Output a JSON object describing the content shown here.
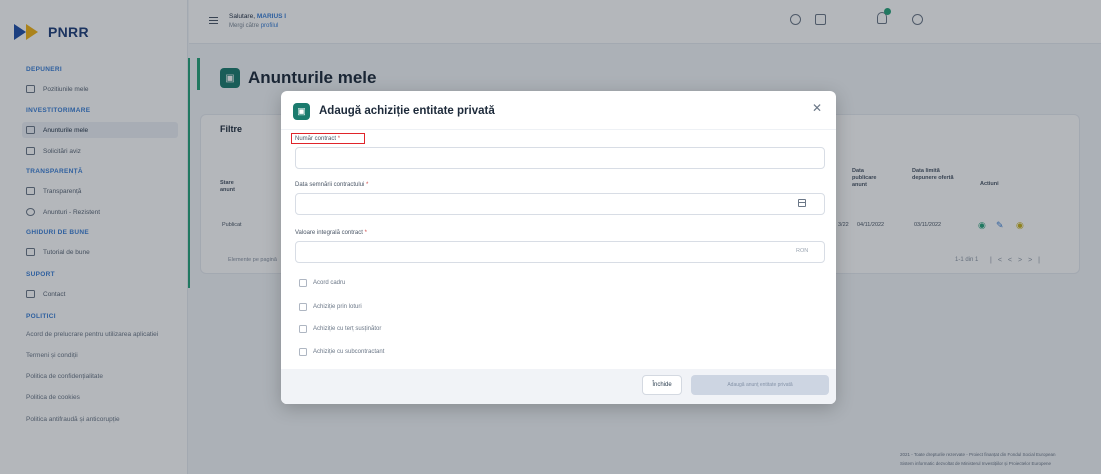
{
  "brand": {
    "name": "PNRR"
  },
  "sidebar": {
    "sections": [
      {
        "title": "DEPUNERI",
        "items": [
          {
            "label": "Pozitiunile mele"
          }
        ]
      },
      {
        "title": "INVESTITORIMARE",
        "items": [
          {
            "label": "Anunturile mele",
            "active": true
          },
          {
            "label": "Solicitări aviz"
          }
        ]
      },
      {
        "title": "TRANSPARENȚĂ",
        "items": [
          {
            "label": "Transparență"
          },
          {
            "label": "Anunturi - Rezistent"
          }
        ]
      },
      {
        "title": "GHIDURI DE BUNE",
        "items": [
          {
            "label": "Tutorial de bune"
          }
        ]
      },
      {
        "title": "SUPORT",
        "items": [
          {
            "label": "Contact"
          }
        ]
      },
      {
        "title": "POLITICI",
        "items": []
      }
    ],
    "policy_links": [
      "Acord de prelucrare pentru utilizarea aplicatiei",
      "Termeni și condiții",
      "Politica de confidențialitate",
      "Politica de cookies",
      "Politica antifraudă și anticorupție"
    ]
  },
  "topbar": {
    "greeting": "Salutare,",
    "user_name": "MARIUS I",
    "sub_prefix": "Mergi către",
    "sub_link": "profilul"
  },
  "page": {
    "title": "Anunturile mele",
    "filters_label": "Filtre",
    "table": {
      "col_status": "Stare anunt",
      "col_publish": "Data publicare anunt",
      "col_deadline": "Data limită depunere ofertă",
      "col_actions": "Actiuni",
      "row_status": "Publicat",
      "row_publish": "04/11/2022",
      "row_deadline": "03/11/2022",
      "row_extra": "3/22",
      "rows_info": "Elemente pe pagină"
    },
    "pager": {
      "label": "1-1 din 1"
    },
    "footer": {
      "line1": "2021 - Toate drepturile rezervate - Proiect finanțat din Fondul Social European",
      "line2": "Sistem informatic dezvoltat de Ministerul Investițiilor și Proiectelor Europene"
    }
  },
  "modal": {
    "title": "Adaugă achiziție entitate privată",
    "fields": {
      "contract_number": {
        "label": "Număr contract",
        "required": "*",
        "value": ""
      },
      "sign_date": {
        "label": "Data semnării contractului",
        "required": "*",
        "value": ""
      },
      "contract_value": {
        "label": "Valoare integrală contract",
        "required": "*",
        "value": "",
        "suffix": "RON"
      }
    },
    "checkboxes": [
      {
        "label": "Acord cadru",
        "checked": false
      },
      {
        "label": "Achiziție prin loturi",
        "checked": false
      },
      {
        "label": "Achiziție cu terț susținător",
        "checked": false
      },
      {
        "label": "Achiziție cu subcontractant",
        "checked": false
      }
    ],
    "buttons": {
      "close": "Închide",
      "add": "Adaugă anunț entitate privată"
    }
  },
  "colors": {
    "accent_green": "#1b7b6e",
    "accent_blue": "#3b7fd6",
    "brand_yellow": "#f2b316",
    "brand_navy": "#1f3e7a",
    "highlight_red": "#e0242a"
  }
}
